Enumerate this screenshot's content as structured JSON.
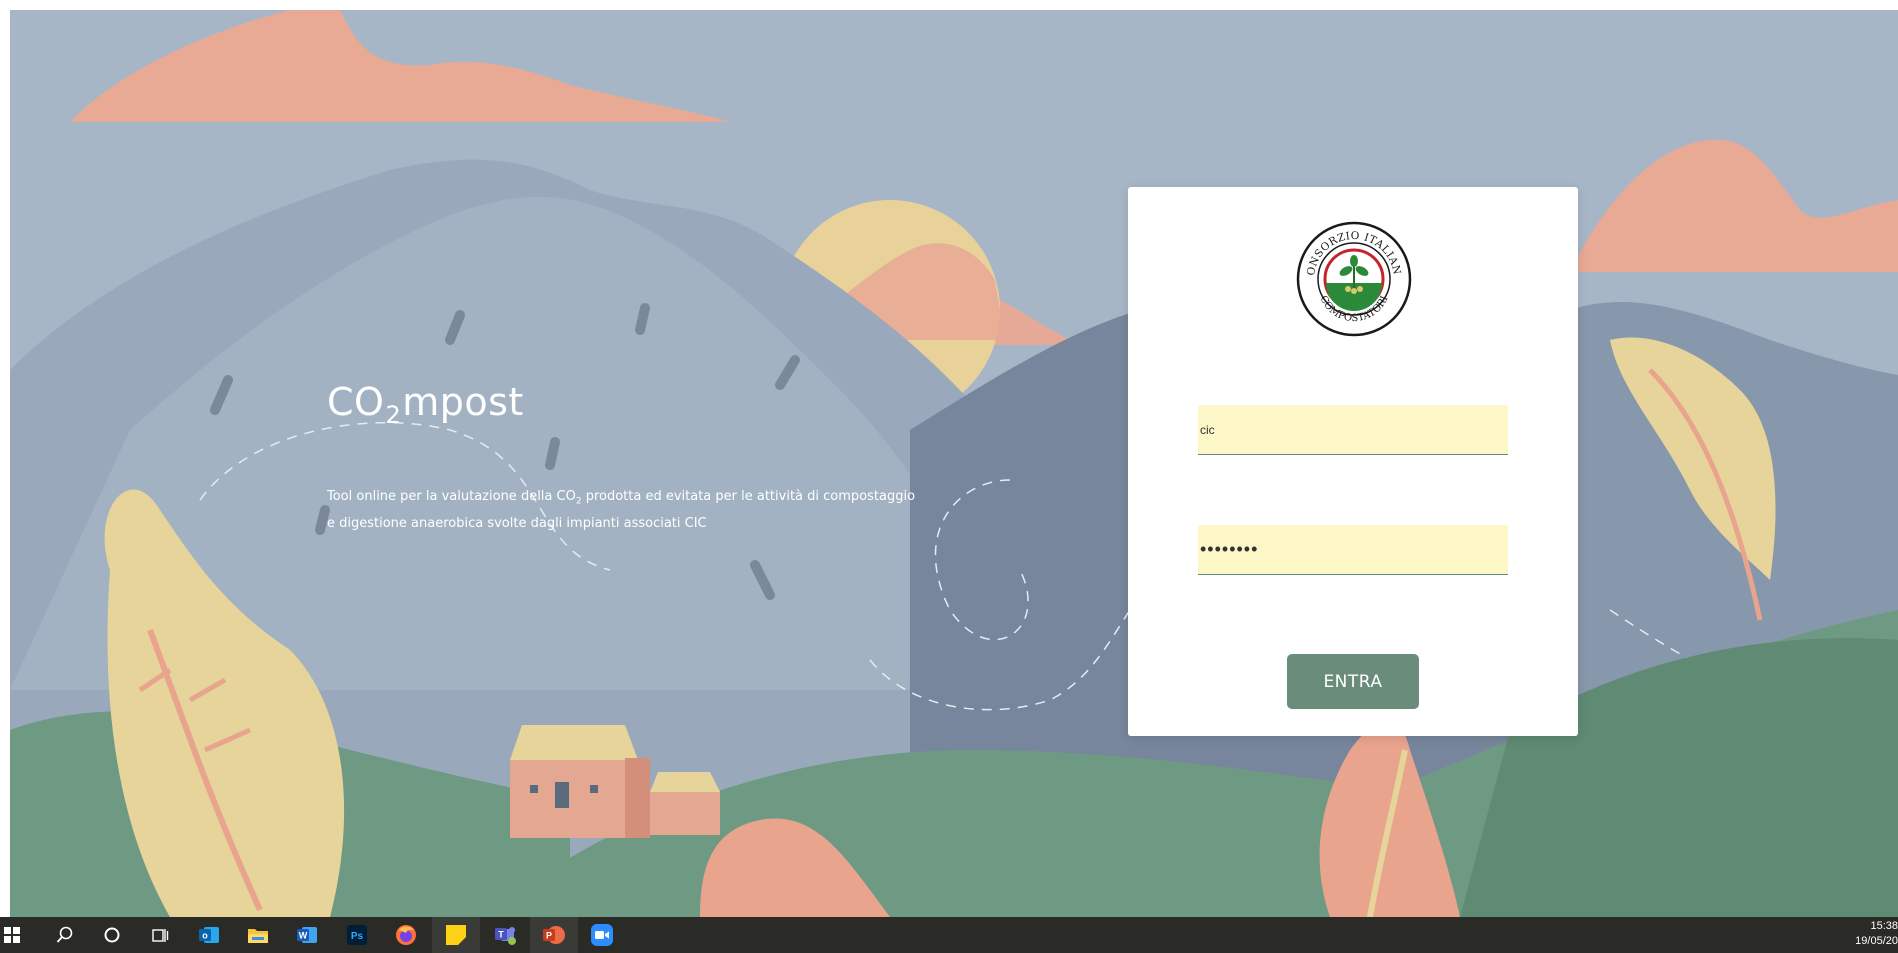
{
  "hero": {
    "title_prefix": "CO",
    "title_sub": "2",
    "title_suffix": "mpost",
    "desc_1": "Tool online per la valutazione della CO",
    "desc_sub": "2",
    "desc_2": " prodotta ed evitata per le attività di compostaggio",
    "desc_3": "e digestione anaerobica svolte dagli impianti associati CIC"
  },
  "login": {
    "logo_top": "CONSORZIO ITALIANO",
    "logo_bottom": "COMPOSTATORI",
    "username_value": "cic",
    "password_value": "••••••••",
    "submit_label": "ENTRA"
  },
  "taskbar": {
    "apps": [
      "windows-start-icon",
      "search-icon",
      "cortana-icon",
      "task-view-icon",
      "outlook-icon",
      "file-explorer-icon",
      "word-icon",
      "photoshop-icon",
      "firefox-icon",
      "sticky-notes-icon",
      "teams-icon",
      "powerpoint-icon",
      "zoom-icon"
    ],
    "icon_labels": {
      "outlook": "o",
      "word": "W",
      "photoshop": "Ps",
      "teams": "T",
      "powerpoint": "P"
    },
    "time": "15:38",
    "date": "19/05/20"
  },
  "colors": {
    "sky": "#a7b6c6",
    "cloud": "#e8a995",
    "mountain": "#8e9db0",
    "hill": "#6e9a84",
    "leaf_yellow": "#e6d49a",
    "leaf_pink": "#e9a48d",
    "button": "#6a8d7b",
    "field_bg": "#fdf6c6",
    "taskbar": "#2a2b27"
  }
}
